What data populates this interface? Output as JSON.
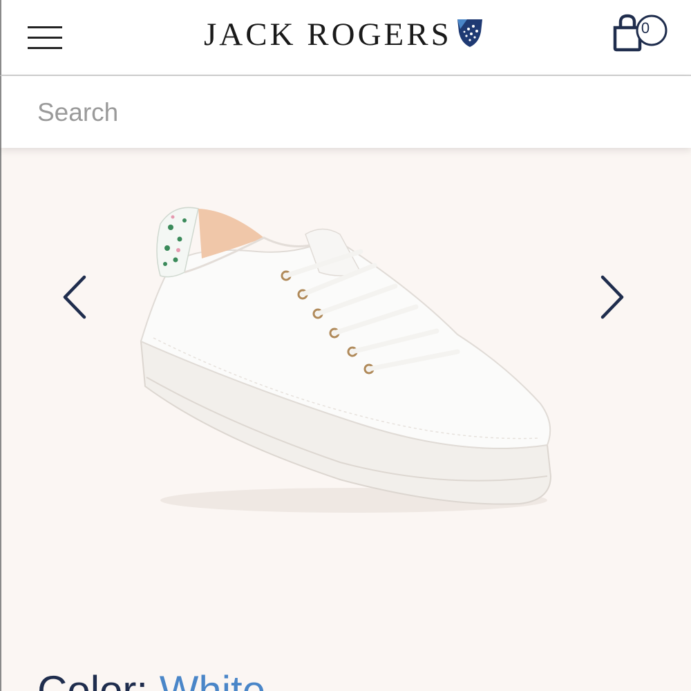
{
  "header": {
    "brand": "JACK ROGERS",
    "cart_count": "0",
    "menu_icon": "hamburger-menu-icon",
    "cart_icon": "shopping-bag-icon",
    "brand_icon": "shield-logo-icon"
  },
  "search": {
    "placeholder": "Search"
  },
  "product": {
    "image_icon": "white-sneaker-image",
    "prev_icon": "chevron-left-icon",
    "next_icon": "chevron-right-icon",
    "color_label": "Color: ",
    "color_value": "White"
  },
  "colors": {
    "navy": "#1f2d4d",
    "link_blue": "#4a86c8",
    "background": "#fbf6f3"
  }
}
